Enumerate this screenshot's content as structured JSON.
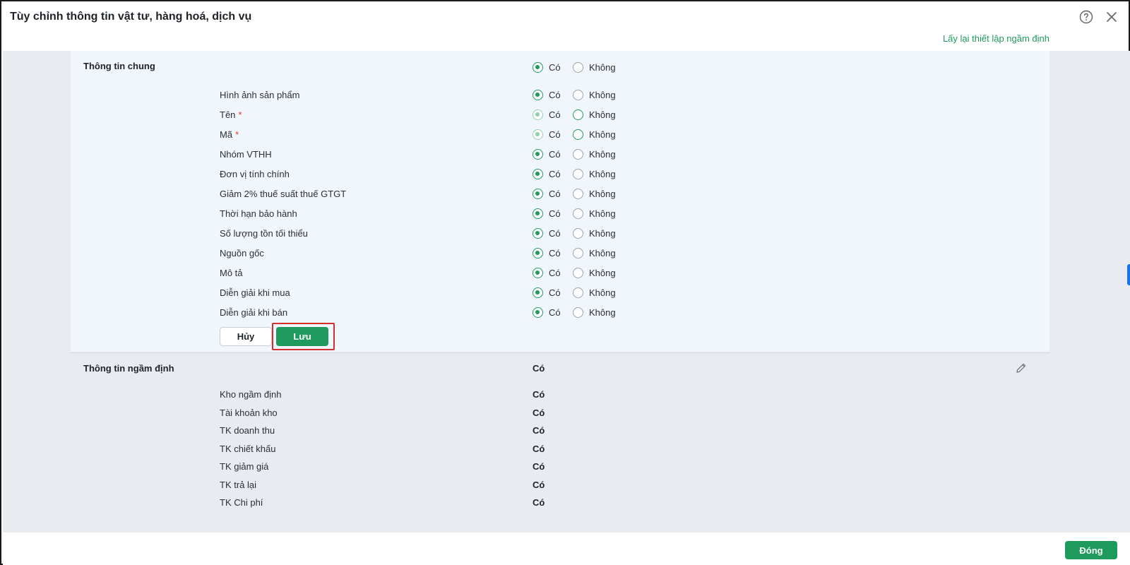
{
  "window": {
    "title": "Tùy chỉnh thông tin vật tư, hàng hoá, dịch vụ",
    "reset_link": "Lấy lại thiết lập ngầm định"
  },
  "general": {
    "title": "Thông tin chung",
    "yes_label": "Có",
    "no_label": "Không",
    "section_value": "yes",
    "rows": [
      {
        "label": "Hình ảnh sản phẩm",
        "required": false,
        "value": "yes",
        "disabled": false
      },
      {
        "label": "Tên",
        "required": true,
        "value": "yes",
        "disabled": true
      },
      {
        "label": "Mã",
        "required": true,
        "value": "yes",
        "disabled": true
      },
      {
        "label": "Nhóm VTHH",
        "required": false,
        "value": "yes",
        "disabled": false
      },
      {
        "label": "Đơn vị tính chính",
        "required": false,
        "value": "yes",
        "disabled": false
      },
      {
        "label": "Giảm 2% thuế suất thuế GTGT",
        "required": false,
        "value": "yes",
        "disabled": false
      },
      {
        "label": "Thời hạn bảo hành",
        "required": false,
        "value": "yes",
        "disabled": false
      },
      {
        "label": "Số lượng tồn tối thiểu",
        "required": false,
        "value": "yes",
        "disabled": false
      },
      {
        "label": "Nguồn gốc",
        "required": false,
        "value": "yes",
        "disabled": false
      },
      {
        "label": "Mô tả",
        "required": false,
        "value": "yes",
        "disabled": false
      },
      {
        "label": "Diễn giải khi mua",
        "required": false,
        "value": "yes",
        "disabled": false
      },
      {
        "label": "Diễn giải khi bán",
        "required": false,
        "value": "yes",
        "disabled": false
      }
    ],
    "required_mark": "*",
    "cancel_label": "Hủy",
    "save_label": "Lưu"
  },
  "defaults": {
    "title": "Thông tin ngầm định",
    "section_value": "Có",
    "rows": [
      {
        "label": "Kho ngầm định",
        "value": "Có"
      },
      {
        "label": "Tài khoản kho",
        "value": "Có"
      },
      {
        "label": "TK doanh thu",
        "value": "Có"
      },
      {
        "label": "TK chiết khấu",
        "value": "Có"
      },
      {
        "label": "TK giảm giá",
        "value": "Có"
      },
      {
        "label": "TK trả lại",
        "value": "Có"
      },
      {
        "label": "TK Chi phí",
        "value": "Có"
      }
    ]
  },
  "footer": {
    "close_label": "Đóng"
  },
  "icons": {
    "help": "help-circle-icon",
    "close": "close-icon",
    "edit": "pencil-icon"
  },
  "colors": {
    "accent": "#1e9a5c",
    "highlight": "#d32f2f",
    "required": "#e53935"
  }
}
